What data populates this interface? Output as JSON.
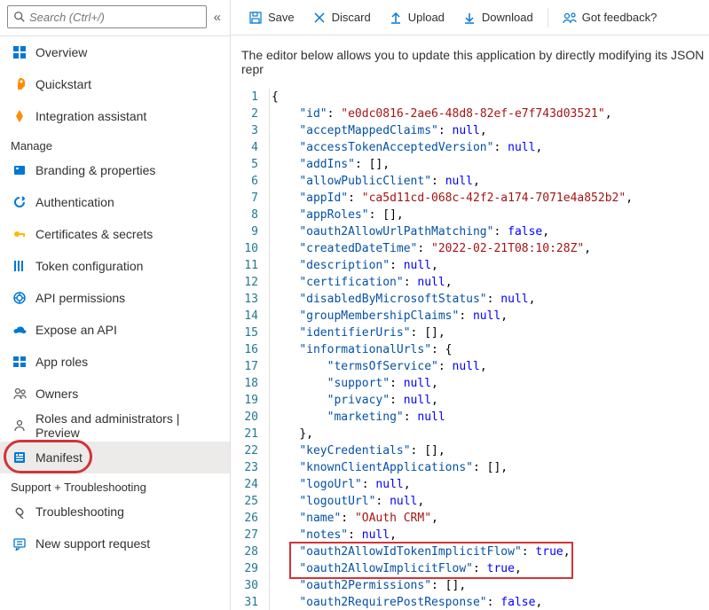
{
  "search": {
    "placeholder": "Search (Ctrl+/)"
  },
  "nav": {
    "top": [
      {
        "k": "overview",
        "label": "Overview",
        "fill": "#0078d4"
      },
      {
        "k": "quickstart",
        "label": "Quickstart",
        "fill": "#ff8c00"
      },
      {
        "k": "integration",
        "label": "Integration assistant",
        "fill": "#ff8c00"
      }
    ],
    "manage_title": "Manage",
    "manage": [
      {
        "k": "branding",
        "label": "Branding & properties",
        "fill": "#0078d4"
      },
      {
        "k": "auth",
        "label": "Authentication",
        "fill": "#0078d4"
      },
      {
        "k": "certs",
        "label": "Certificates & secrets",
        "fill": "#ffb900"
      },
      {
        "k": "token",
        "label": "Token configuration",
        "fill": "#0078d4"
      },
      {
        "k": "api-perm",
        "label": "API permissions",
        "fill": "#0078d4"
      },
      {
        "k": "expose",
        "label": "Expose an API",
        "fill": "#0078d4"
      },
      {
        "k": "approles",
        "label": "App roles",
        "fill": "#0078d4"
      },
      {
        "k": "owners",
        "label": "Owners",
        "fill": "#605e5c"
      },
      {
        "k": "roles",
        "label": "Roles and administrators | Preview",
        "fill": "#605e5c"
      },
      {
        "k": "manifest",
        "label": "Manifest",
        "fill": "#0078d4",
        "active": true,
        "circled": true
      }
    ],
    "support_title": "Support + Troubleshooting",
    "support": [
      {
        "k": "troubleshoot",
        "label": "Troubleshooting",
        "fill": "#605e5c"
      },
      {
        "k": "newreq",
        "label": "New support request",
        "fill": "#0078d4"
      }
    ]
  },
  "toolbar": {
    "save": "Save",
    "discard": "Discard",
    "upload": "Upload",
    "download": "Download",
    "feedback": "Got feedback?"
  },
  "description": "The editor below allows you to update this application by directly modifying its JSON repr",
  "code_lines": [
    {
      "n": 1,
      "ind": 0,
      "txt": [
        [
          "brace",
          "{"
        ]
      ]
    },
    {
      "n": 2,
      "ind": 1,
      "txt": [
        [
          "key",
          "\"id\""
        ],
        [
          "punc",
          ": "
        ],
        [
          "str",
          "\"e0dc0816-2ae6-48d8-82ef-e7f743d03521\""
        ],
        [
          "punc",
          ","
        ]
      ]
    },
    {
      "n": 3,
      "ind": 1,
      "txt": [
        [
          "key",
          "\"acceptMappedClaims\""
        ],
        [
          "punc",
          ": "
        ],
        [
          "null",
          "null"
        ],
        [
          "punc",
          ","
        ]
      ]
    },
    {
      "n": 4,
      "ind": 1,
      "txt": [
        [
          "key",
          "\"accessTokenAcceptedVersion\""
        ],
        [
          "punc",
          ": "
        ],
        [
          "null",
          "null"
        ],
        [
          "punc",
          ","
        ]
      ]
    },
    {
      "n": 5,
      "ind": 1,
      "txt": [
        [
          "key",
          "\"addIns\""
        ],
        [
          "punc",
          ": []"
        ],
        [
          "punc",
          ","
        ]
      ]
    },
    {
      "n": 6,
      "ind": 1,
      "txt": [
        [
          "key",
          "\"allowPublicClient\""
        ],
        [
          "punc",
          ": "
        ],
        [
          "null",
          "null"
        ],
        [
          "punc",
          ","
        ]
      ]
    },
    {
      "n": 7,
      "ind": 1,
      "txt": [
        [
          "key",
          "\"appId\""
        ],
        [
          "punc",
          ": "
        ],
        [
          "str",
          "\"ca5d11cd-068c-42f2-a174-7071e4a852b2\""
        ],
        [
          "punc",
          ","
        ]
      ]
    },
    {
      "n": 8,
      "ind": 1,
      "txt": [
        [
          "key",
          "\"appRoles\""
        ],
        [
          "punc",
          ": []"
        ],
        [
          "punc",
          ","
        ]
      ]
    },
    {
      "n": 9,
      "ind": 1,
      "txt": [
        [
          "key",
          "\"oauth2AllowUrlPathMatching\""
        ],
        [
          "punc",
          ": "
        ],
        [
          "bool",
          "false"
        ],
        [
          "punc",
          ","
        ]
      ]
    },
    {
      "n": 10,
      "ind": 1,
      "txt": [
        [
          "key",
          "\"createdDateTime\""
        ],
        [
          "punc",
          ": "
        ],
        [
          "str",
          "\"2022-02-21T08:10:28Z\""
        ],
        [
          "punc",
          ","
        ]
      ]
    },
    {
      "n": 11,
      "ind": 1,
      "txt": [
        [
          "key",
          "\"description\""
        ],
        [
          "punc",
          ": "
        ],
        [
          "null",
          "null"
        ],
        [
          "punc",
          ","
        ]
      ]
    },
    {
      "n": 12,
      "ind": 1,
      "txt": [
        [
          "key",
          "\"certification\""
        ],
        [
          "punc",
          ": "
        ],
        [
          "null",
          "null"
        ],
        [
          "punc",
          ","
        ]
      ]
    },
    {
      "n": 13,
      "ind": 1,
      "txt": [
        [
          "key",
          "\"disabledByMicrosoftStatus\""
        ],
        [
          "punc",
          ": "
        ],
        [
          "null",
          "null"
        ],
        [
          "punc",
          ","
        ]
      ]
    },
    {
      "n": 14,
      "ind": 1,
      "txt": [
        [
          "key",
          "\"groupMembershipClaims\""
        ],
        [
          "punc",
          ": "
        ],
        [
          "null",
          "null"
        ],
        [
          "punc",
          ","
        ]
      ]
    },
    {
      "n": 15,
      "ind": 1,
      "txt": [
        [
          "key",
          "\"identifierUris\""
        ],
        [
          "punc",
          ": []"
        ],
        [
          "punc",
          ","
        ]
      ]
    },
    {
      "n": 16,
      "ind": 1,
      "txt": [
        [
          "key",
          "\"informationalUrls\""
        ],
        [
          "punc",
          ": {"
        ]
      ]
    },
    {
      "n": 17,
      "ind": 2,
      "txt": [
        [
          "key",
          "\"termsOfService\""
        ],
        [
          "punc",
          ": "
        ],
        [
          "null",
          "null"
        ],
        [
          "punc",
          ","
        ]
      ]
    },
    {
      "n": 18,
      "ind": 2,
      "txt": [
        [
          "key",
          "\"support\""
        ],
        [
          "punc",
          ": "
        ],
        [
          "null",
          "null"
        ],
        [
          "punc",
          ","
        ]
      ]
    },
    {
      "n": 19,
      "ind": 2,
      "txt": [
        [
          "key",
          "\"privacy\""
        ],
        [
          "punc",
          ": "
        ],
        [
          "null",
          "null"
        ],
        [
          "punc",
          ","
        ]
      ]
    },
    {
      "n": 20,
      "ind": 2,
      "txt": [
        [
          "key",
          "\"marketing\""
        ],
        [
          "punc",
          ": "
        ],
        [
          "null",
          "null"
        ]
      ]
    },
    {
      "n": 21,
      "ind": 1,
      "txt": [
        [
          "brace",
          "}"
        ],
        [
          "punc",
          ","
        ]
      ]
    },
    {
      "n": 22,
      "ind": 1,
      "txt": [
        [
          "key",
          "\"keyCredentials\""
        ],
        [
          "punc",
          ": []"
        ],
        [
          "punc",
          ","
        ]
      ]
    },
    {
      "n": 23,
      "ind": 1,
      "txt": [
        [
          "key",
          "\"knownClientApplications\""
        ],
        [
          "punc",
          ": []"
        ],
        [
          "punc",
          ","
        ]
      ]
    },
    {
      "n": 24,
      "ind": 1,
      "txt": [
        [
          "key",
          "\"logoUrl\""
        ],
        [
          "punc",
          ": "
        ],
        [
          "null",
          "null"
        ],
        [
          "punc",
          ","
        ]
      ]
    },
    {
      "n": 25,
      "ind": 1,
      "txt": [
        [
          "key",
          "\"logoutUrl\""
        ],
        [
          "punc",
          ": "
        ],
        [
          "null",
          "null"
        ],
        [
          "punc",
          ","
        ]
      ]
    },
    {
      "n": 26,
      "ind": 1,
      "txt": [
        [
          "key",
          "\"name\""
        ],
        [
          "punc",
          ": "
        ],
        [
          "str",
          "\"OAuth CRM\""
        ],
        [
          "punc",
          ","
        ]
      ]
    },
    {
      "n": 27,
      "ind": 1,
      "txt": [
        [
          "key",
          "\"notes\""
        ],
        [
          "punc",
          ": "
        ],
        [
          "null",
          "null"
        ],
        [
          "punc",
          ","
        ]
      ]
    },
    {
      "n": 28,
      "ind": 1,
      "txt": [
        [
          "key",
          "\"oauth2AllowIdTokenImplicitFlow\""
        ],
        [
          "punc",
          ": "
        ],
        [
          "bool",
          "true"
        ],
        [
          "punc",
          ","
        ]
      ]
    },
    {
      "n": 29,
      "ind": 1,
      "txt": [
        [
          "key",
          "\"oauth2AllowImplicitFlow\""
        ],
        [
          "punc",
          ": "
        ],
        [
          "bool",
          "true"
        ],
        [
          "punc",
          ","
        ]
      ]
    },
    {
      "n": 30,
      "ind": 1,
      "txt": [
        [
          "key",
          "\"oauth2Permissions\""
        ],
        [
          "punc",
          ": []"
        ],
        [
          "punc",
          ","
        ]
      ]
    },
    {
      "n": 31,
      "ind": 1,
      "txt": [
        [
          "key",
          "\"oauth2RequirePostResponse\""
        ],
        [
          "punc",
          ": "
        ],
        [
          "bool",
          "false"
        ],
        [
          "punc",
          ","
        ]
      ]
    }
  ],
  "highlight": {
    "startLine": 28,
    "endLine": 29
  }
}
